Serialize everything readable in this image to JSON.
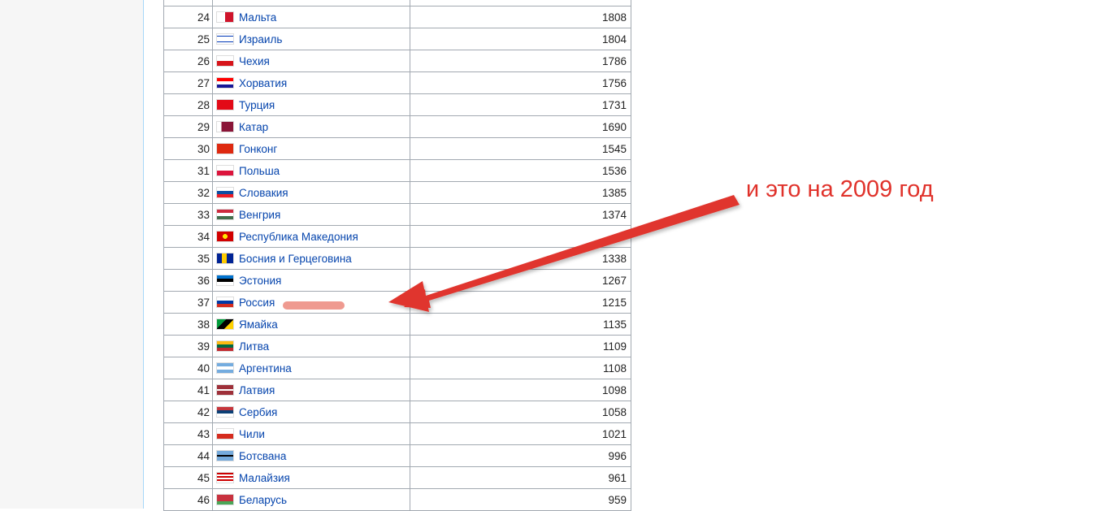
{
  "table": {
    "top_partial_row": {
      "rank": "",
      "country": "",
      "value": ""
    },
    "rows": [
      {
        "rank": "24",
        "country": "Мальта",
        "value": "1808",
        "flag": "malta-flag-icon"
      },
      {
        "rank": "25",
        "country": "Израиль",
        "value": "1804",
        "flag": "israel-flag-icon"
      },
      {
        "rank": "26",
        "country": "Чехия",
        "value": "1786",
        "flag": "czech-flag-icon"
      },
      {
        "rank": "27",
        "country": "Хорватия",
        "value": "1756",
        "flag": "croatia-flag-icon"
      },
      {
        "rank": "28",
        "country": "Турция",
        "value": "1731",
        "flag": "turkey-flag-icon"
      },
      {
        "rank": "29",
        "country": "Катар",
        "value": "1690",
        "flag": "qatar-flag-icon"
      },
      {
        "rank": "30",
        "country": "Гонконг",
        "value": "1545",
        "flag": "hongkong-flag-icon"
      },
      {
        "rank": "31",
        "country": "Польша",
        "value": "1536",
        "flag": "poland-flag-icon"
      },
      {
        "rank": "32",
        "country": "Словакия",
        "value": "1385",
        "flag": "slovakia-flag-icon"
      },
      {
        "rank": "33",
        "country": "Венгрия",
        "value": "1374",
        "flag": "hungary-flag-icon"
      },
      {
        "rank": "34",
        "country": "Республика Македония",
        "value": "",
        "flag": "macedonia-flag-icon"
      },
      {
        "rank": "35",
        "country": "Босния и Герцеговина",
        "value": "1338",
        "flag": "bosnia-flag-icon"
      },
      {
        "rank": "36",
        "country": "Эстония",
        "value": "1267",
        "flag": "estonia-flag-icon"
      },
      {
        "rank": "37",
        "country": "Россия",
        "value": "1215",
        "flag": "russia-flag-icon"
      },
      {
        "rank": "38",
        "country": "Ямайка",
        "value": "1135",
        "flag": "jamaica-flag-icon"
      },
      {
        "rank": "39",
        "country": "Литва",
        "value": "1109",
        "flag": "lithuania-flag-icon"
      },
      {
        "rank": "40",
        "country": "Аргентина",
        "value": "1108",
        "flag": "argentina-flag-icon"
      },
      {
        "rank": "41",
        "country": "Латвия",
        "value": "1098",
        "flag": "latvia-flag-icon"
      },
      {
        "rank": "42",
        "country": "Сербия",
        "value": "1058",
        "flag": "serbia-flag-icon"
      },
      {
        "rank": "43",
        "country": "Чили",
        "value": "1021",
        "flag": "chile-flag-icon"
      },
      {
        "rank": "44",
        "country": "Ботсвана",
        "value": "996",
        "flag": "botswana-flag-icon"
      },
      {
        "rank": "45",
        "country": "Малайзия",
        "value": "961",
        "flag": "malaysia-flag-icon"
      },
      {
        "rank": "46",
        "country": "Беларусь",
        "value": "959",
        "flag": "belarus-flag-icon"
      }
    ]
  },
  "annotation": {
    "text": "и это на 2009 год",
    "color": "#e0322b",
    "highlight_color": "#ef9a90"
  },
  "colors": {
    "link": "#0645ad",
    "border": "#a2a9b1",
    "sidebar_border": "#a7d7f9"
  }
}
